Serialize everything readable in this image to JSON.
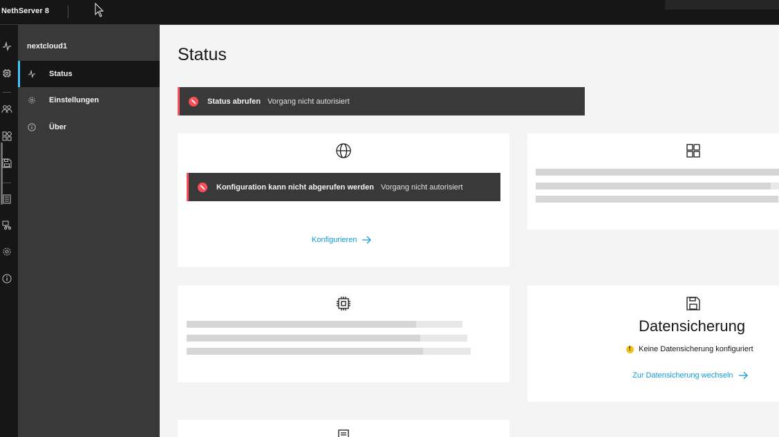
{
  "header": {
    "brand": "NethServer 8"
  },
  "rail": {
    "icons": [
      "activity-icon",
      "chip-icon",
      "users-icon",
      "apps-icon",
      "save-icon",
      "logs-icon",
      "network-icon",
      "gear-icon",
      "info-icon"
    ]
  },
  "sidenav": {
    "app_name": "nextcloud1",
    "items": [
      {
        "label": "Status",
        "icon": "activity-icon",
        "active": true
      },
      {
        "label": "Einstellungen",
        "icon": "gear-icon",
        "active": false
      },
      {
        "label": "Über",
        "icon": "info-icon",
        "active": false
      }
    ]
  },
  "main": {
    "title": "Status",
    "status_error": {
      "title": "Status abrufen",
      "subtitle": "Vorgang nicht autorisiert"
    },
    "config_card": {
      "icon": "globe-icon",
      "error_title": "Konfiguration kann nicht abgerufen werden",
      "error_subtitle": "Vorgang nicht autorisiert",
      "link_label": "Konfigurieren"
    },
    "apps_card": {
      "icon": "apps-icon"
    },
    "node_card": {
      "icon": "chip-icon"
    },
    "backup_card": {
      "icon": "save-icon",
      "title": "Datensicherung",
      "warning": "Keine Datensicherung konfiguriert",
      "link_label": "Zur Datensicherung wechseln"
    },
    "logs_card": {
      "icon": "logs-icon"
    }
  },
  "colors": {
    "header_bg": "#161616",
    "sidenav_bg": "#393939",
    "active_indicator": "#3ec8ff",
    "error_red": "#fa4d56",
    "warning_yellow": "#f1c21b",
    "link_blue": "#0f9bd7"
  }
}
